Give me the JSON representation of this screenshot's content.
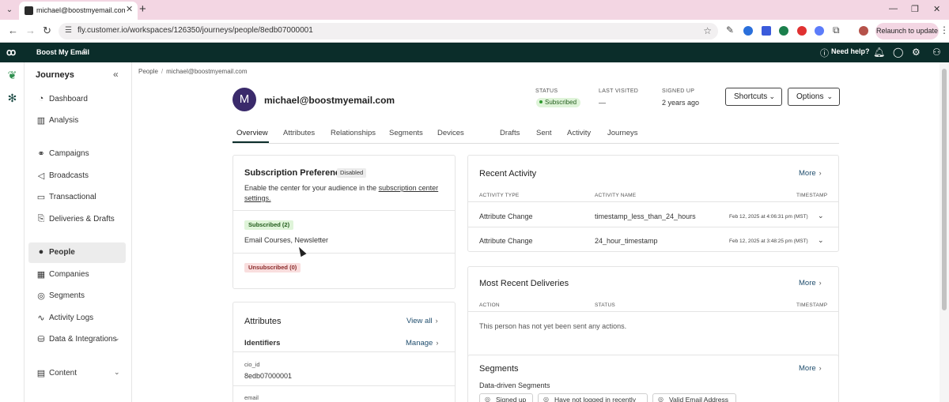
{
  "browser": {
    "tab_title": "michael@boostmyemail.com | Pe",
    "url": "fly.customer.io/workspaces/126350/journeys/people/8edb07000001",
    "relaunch_label": "Relaunch to update",
    "ext_colors": [
      "#2a6fdb",
      "#3b5bdb",
      "#1b7f4c",
      "#e03131",
      "#5c7cfa"
    ]
  },
  "app_header": {
    "workspace_name": "Boost My Email",
    "need_help": "Need help?"
  },
  "sidebar": {
    "title": "Journeys",
    "items": [
      {
        "label": "Dashboard",
        "icon": "dashboard-icon"
      },
      {
        "label": "Analysis",
        "icon": "bar-chart-icon"
      },
      {
        "label": "Campaigns",
        "icon": "campaign-icon"
      },
      {
        "label": "Broadcasts",
        "icon": "broadcast-icon"
      },
      {
        "label": "Transactional",
        "icon": "transactional-icon"
      },
      {
        "label": "Deliveries & Drafts",
        "icon": "deliveries-icon"
      },
      {
        "label": "People",
        "icon": "person-icon"
      },
      {
        "label": "Companies",
        "icon": "building-icon"
      },
      {
        "label": "Segments",
        "icon": "segments-icon"
      },
      {
        "label": "Activity Logs",
        "icon": "activity-icon"
      },
      {
        "label": "Data & Integrations",
        "icon": "database-icon"
      },
      {
        "label": "Content",
        "icon": "content-icon"
      }
    ]
  },
  "breadcrumb": {
    "parent": "People",
    "current": "michael@boostmyemail.com"
  },
  "person": {
    "avatar_initial": "M",
    "email": "michael@boostmyemail.com",
    "status_label": "STATUS",
    "status_value": "Subscribed",
    "last_visited_label": "LAST VISITED",
    "last_visited_value": "—",
    "signed_up_label": "SIGNED UP",
    "signed_up_value": "2 years ago"
  },
  "buttons": {
    "shortcuts": "Shortcuts",
    "options": "Options"
  },
  "tabs": [
    "Overview",
    "Attributes",
    "Relationships",
    "Segments",
    "Devices",
    "Drafts",
    "Sent",
    "Activity",
    "Journeys"
  ],
  "subscription": {
    "title": "Subscription Preferences",
    "badge": "Disabled",
    "text_before_link": "Enable the center for your audience in the ",
    "link_text": "subscription center settings.",
    "subscribed_label": "Subscribed (2)",
    "subscribed_topics": "Email Courses, Newsletter",
    "unsubscribed_label": "Unsubscribed (0)"
  },
  "attributes": {
    "title": "Attributes",
    "view_all": "View all",
    "identifiers_label": "Identifiers",
    "manage": "Manage",
    "cio_id_label": "cio_id",
    "cio_id_value": "8edb07000001",
    "email_label": "email"
  },
  "recent_activity": {
    "title": "Recent Activity",
    "more": "More",
    "columns": [
      "ACTIVITY TYPE",
      "ACTIVITY NAME",
      "TIMESTAMP"
    ],
    "rows": [
      {
        "type": "Attribute Change",
        "name": "timestamp_less_than_24_hours",
        "timestamp": "Feb 12, 2025 at 4:06:31 pm (MST)"
      },
      {
        "type": "Attribute Change",
        "name": "24_hour_timestamp",
        "timestamp": "Feb 12, 2025 at 3:48:25 pm (MST)"
      }
    ]
  },
  "deliveries": {
    "title": "Most Recent Deliveries",
    "more": "More",
    "columns": [
      "ACTION",
      "STATUS",
      "TIMESTAMP"
    ],
    "empty": "This person has not yet been sent any actions."
  },
  "segments": {
    "title": "Segments",
    "more": "More",
    "subtitle": "Data-driven Segments",
    "chips": [
      "Signed up",
      "Have not logged in recently",
      "Valid Email Address"
    ]
  }
}
